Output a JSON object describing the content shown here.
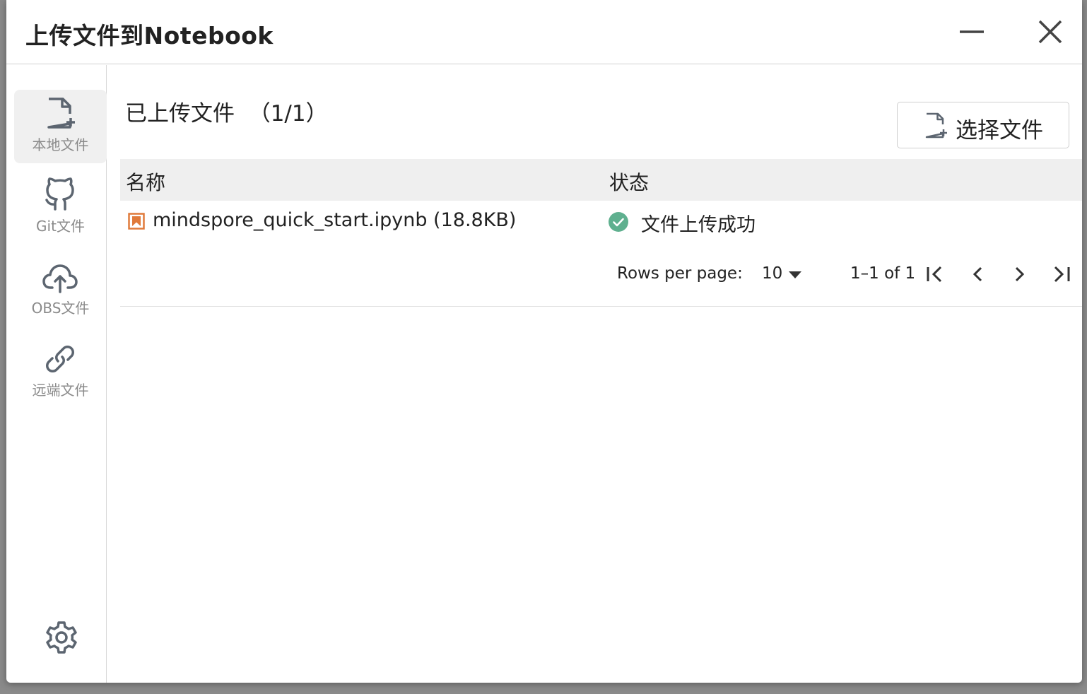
{
  "dialog": {
    "title": "上传文件到Notebook"
  },
  "sidebar": {
    "items": [
      {
        "label": "本地文件",
        "icon": "file-add-icon",
        "active": true
      },
      {
        "label": "Git文件",
        "icon": "github-icon",
        "active": false
      },
      {
        "label": "OBS文件",
        "icon": "cloud-upload-icon",
        "active": false
      },
      {
        "label": "远端文件",
        "icon": "link-icon",
        "active": false
      }
    ],
    "settings_icon": "gear-icon"
  },
  "main": {
    "section_title": "已上传文件  （1/1）",
    "select_button_label": "选择文件",
    "table": {
      "columns": [
        "名称",
        "状态"
      ],
      "rows": [
        {
          "name": "mindspore_quick_start.ipynb (18.8KB)",
          "status": "文件上传成功",
          "status_color": "#5fb08f",
          "file_icon_color": "#e07a3a"
        }
      ]
    },
    "pagination": {
      "rows_per_page_label": "Rows per page:",
      "rows_per_page_value": "10",
      "range_text": "1–1 of 1"
    }
  },
  "colors": {
    "icon_gray": "#5c6570",
    "success": "#5fb08f",
    "file_orange": "#e07a3a"
  }
}
